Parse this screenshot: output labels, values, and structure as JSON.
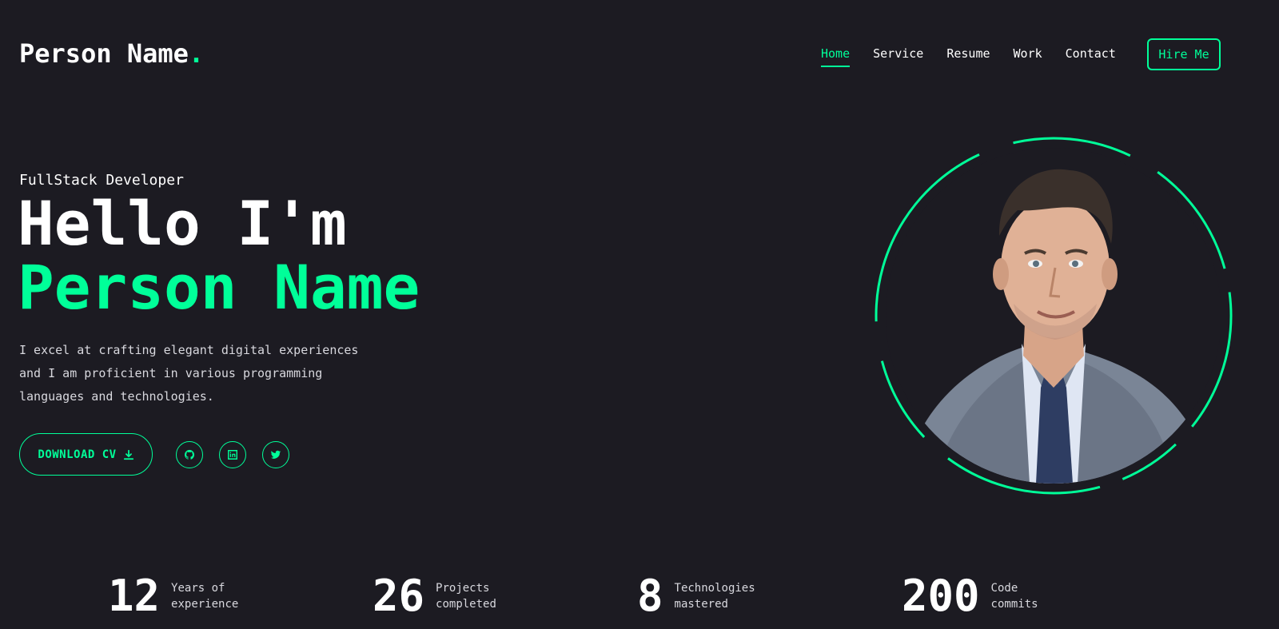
{
  "header": {
    "logo_text": "Person Name",
    "logo_dot": ".",
    "nav": [
      {
        "label": "Home",
        "active": true
      },
      {
        "label": "Service",
        "active": false
      },
      {
        "label": "Resume",
        "active": false
      },
      {
        "label": "Work",
        "active": false
      },
      {
        "label": "Contact",
        "active": false
      }
    ],
    "hire_button": "Hire Me"
  },
  "hero": {
    "role": "FullStack Developer",
    "greeting": "Hello I'm",
    "name": "Person Name",
    "description": "I excel at crafting elegant digital experiences and I am proficient in various programming languages and technologies.",
    "download_label": "DOWNLOAD CV",
    "socials": [
      "github-icon",
      "linkedin-icon",
      "twitter-icon"
    ]
  },
  "stats": [
    {
      "value": "12",
      "label": "Years of\nexperience"
    },
    {
      "value": "26",
      "label": "Projects\ncompleted"
    },
    {
      "value": "8",
      "label": "Technologies\nmastered"
    },
    {
      "value": "200",
      "label": "Code\ncommits"
    }
  ],
  "colors": {
    "background": "#1c1b22",
    "accent": "#00ff99",
    "text": "#ffffff"
  }
}
